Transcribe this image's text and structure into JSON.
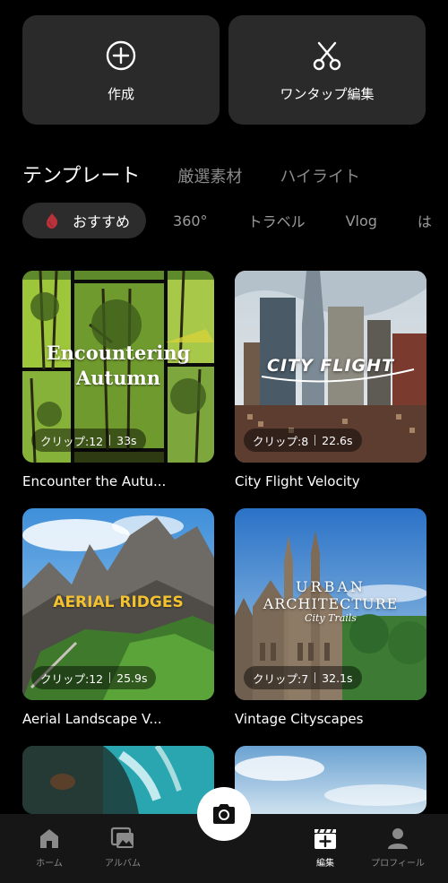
{
  "actions": {
    "create": {
      "label": "作成",
      "icon": "plus-circle-icon"
    },
    "onetap": {
      "label": "ワンタップ編集",
      "icon": "scissors-icon"
    }
  },
  "section_tabs": [
    {
      "label": "テンプレート",
      "active": true
    },
    {
      "label": "厳選素材",
      "active": false
    },
    {
      "label": "ハイライト",
      "active": false
    }
  ],
  "chips": [
    {
      "label": "おすすめ",
      "active": true,
      "icon": "fig-icon"
    },
    {
      "label": "360°"
    },
    {
      "label": "トラベル"
    },
    {
      "label": "Vlog"
    },
    {
      "label": "は"
    }
  ],
  "templates": [
    {
      "title": "Encounter the Autu...",
      "overlay": [
        "Encountering",
        "Autumn"
      ],
      "clips": "クリップ:12",
      "duration": "33s"
    },
    {
      "title": "City Flight Velocity",
      "overlay": [
        "CITY FLIGHT"
      ],
      "clips": "クリップ:8",
      "duration": "22.6s"
    },
    {
      "title": "Aerial Landscape V...",
      "overlay": [
        "AERIAL RIDGES"
      ],
      "clips": "クリップ:12",
      "duration": "25.9s"
    },
    {
      "title": "Vintage Cityscapes",
      "overlay": [
        "URBAN",
        "ARCHITECTURE",
        "City Trails"
      ],
      "clips": "クリップ:7",
      "duration": "32.1s"
    },
    {
      "title": "",
      "overlay": [],
      "clips": "",
      "duration": ""
    },
    {
      "title": "",
      "overlay": [],
      "clips": "",
      "duration": ""
    }
  ],
  "bottom_nav": [
    {
      "label": "ホーム",
      "icon": "home-icon",
      "active": false
    },
    {
      "label": "アルバム",
      "icon": "album-icon",
      "active": false
    },
    {
      "label": "",
      "icon": "camera-icon",
      "active": false
    },
    {
      "label": "編集",
      "icon": "edit-clapper-icon",
      "active": true
    },
    {
      "label": "プロフィール",
      "icon": "profile-icon",
      "active": false
    }
  ],
  "colors": {
    "background": "#000000",
    "card": "#2a2a2a",
    "chip_active": "#2c2c2c",
    "inactive_text": "#8a8a8a",
    "aerial_text": "#f2c230"
  }
}
